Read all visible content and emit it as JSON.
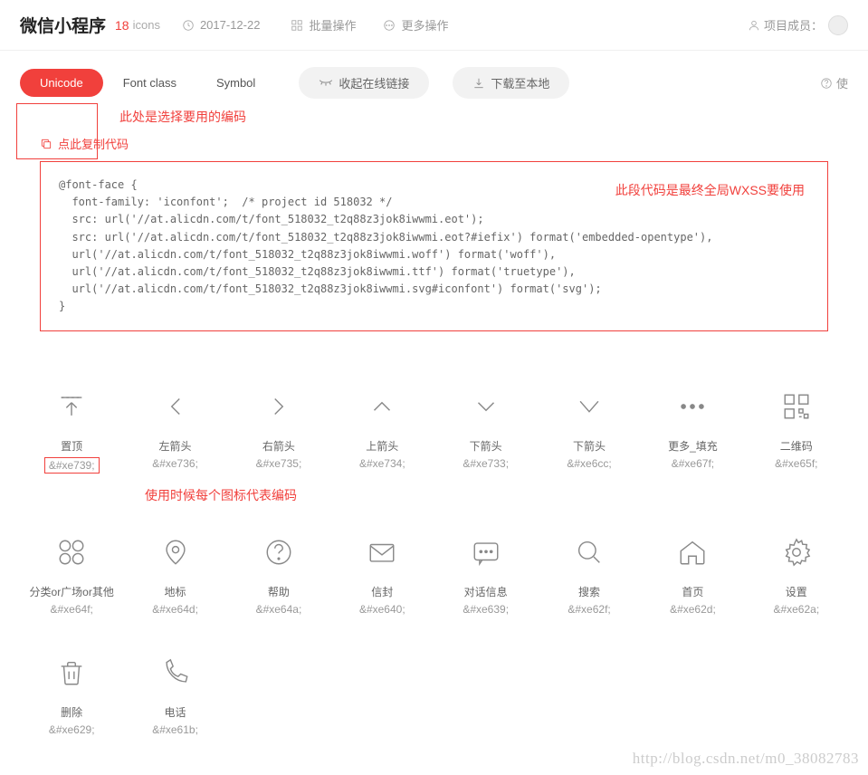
{
  "header": {
    "title": "微信小程序",
    "count": "18",
    "count_label": "icons",
    "date": "2017-12-22",
    "batch": "批量操作",
    "more": "更多操作",
    "members_label": "项目成员：",
    "help_label": "使"
  },
  "tabs": {
    "unicode": "Unicode",
    "fontclass": "Font class",
    "symbol": "Symbol"
  },
  "actions": {
    "collapse": "收起在线链接",
    "download": "下载至本地"
  },
  "annotations": {
    "tabs_note": "此处是选择要用的编码",
    "code_note": "此段代码是最终全局WXSS要使用",
    "icon_note": "使用时候每个图标代表编码"
  },
  "copy_label": "点此复制代码",
  "code": "@font-face {\n  font-family: 'iconfont';  /* project id 518032 */\n  src: url('//at.alicdn.com/t/font_518032_t2q88z3jok8iwwmi.eot');\n  src: url('//at.alicdn.com/t/font_518032_t2q88z3jok8iwwmi.eot?#iefix') format('embedded-opentype'),\n  url('//at.alicdn.com/t/font_518032_t2q88z3jok8iwwmi.woff') format('woff'),\n  url('//at.alicdn.com/t/font_518032_t2q88z3jok8iwwmi.ttf') format('truetype'),\n  url('//at.alicdn.com/t/font_518032_t2q88z3jok8iwwmi.svg#iconfont') format('svg');\n}",
  "icons": [
    {
      "name": "置顶",
      "code": "&#xe739;"
    },
    {
      "name": "左箭头",
      "code": "&#xe736;"
    },
    {
      "name": "右箭头",
      "code": "&#xe735;"
    },
    {
      "name": "上箭头",
      "code": "&#xe734;"
    },
    {
      "name": "下箭头",
      "code": "&#xe733;"
    },
    {
      "name": "下箭头",
      "code": "&#xe6cc;"
    },
    {
      "name": "更多_填充",
      "code": "&#xe67f;"
    },
    {
      "name": "二维码",
      "code": "&#xe65f;"
    },
    {
      "name": "分类or广场or其他",
      "code": "&#xe64f;"
    },
    {
      "name": "地标",
      "code": "&#xe64d;"
    },
    {
      "name": "帮助",
      "code": "&#xe64a;"
    },
    {
      "name": "信封",
      "code": "&#xe640;"
    },
    {
      "name": "对话信息",
      "code": "&#xe639;"
    },
    {
      "name": "搜索",
      "code": "&#xe62f;"
    },
    {
      "name": "首页",
      "code": "&#xe62d;"
    },
    {
      "name": "设置",
      "code": "&#xe62a;"
    },
    {
      "name": "删除",
      "code": "&#xe629;"
    },
    {
      "name": "电话",
      "code": "&#xe61b;"
    }
  ],
  "watermark": "http://blog.csdn.net/m0_38082783"
}
